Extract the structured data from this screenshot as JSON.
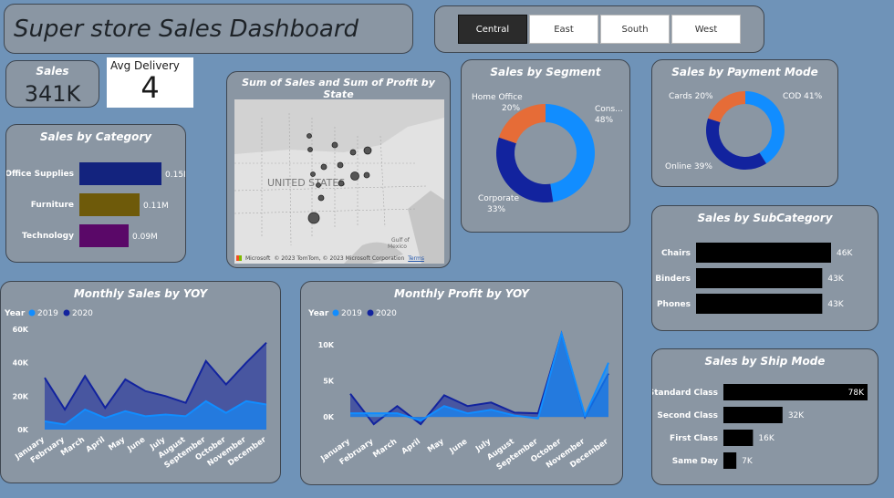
{
  "title": "Super store Sales Dashboard",
  "region_slicer": {
    "options": [
      "Central",
      "East",
      "South",
      "West"
    ],
    "selected": "Central"
  },
  "kpi_sales": {
    "label": "Sales",
    "value": "341K"
  },
  "kpi_delivery": {
    "label": "Avg Delivery",
    "value": "4"
  },
  "map": {
    "title": "Sum of Sales and Sum of Profit by State",
    "country_label": "UNITED STATES",
    "gulf_label": "Gulf of",
    "gulf_label2": "Mexico",
    "copyright": "© 2023 TomTom, © 2023 Microsoft Corporation",
    "terms": "Terms",
    "brand": "Microsoft"
  },
  "chart_data": [
    {
      "id": "category",
      "type": "bar",
      "title": "Sales by Category",
      "categories": [
        "Office Supplies",
        "Furniture",
        "Technology"
      ],
      "values": [
        0.15,
        0.11,
        0.09
      ],
      "labels": [
        "0.15M",
        "0.11M",
        "0.09M"
      ],
      "colors": [
        "#13237e",
        "#6e5a0a",
        "#5a0868"
      ]
    },
    {
      "id": "segment",
      "type": "pie",
      "title": "Sales by Segment",
      "categories": [
        "Consumer",
        "Corporate",
        "Home Office"
      ],
      "values": [
        48,
        33,
        20
      ],
      "labels": [
        [
          "Cons...",
          "48%"
        ],
        [
          "Corporate",
          "33%"
        ],
        [
          "Home Office",
          "20%"
        ]
      ],
      "colors": [
        "#118dff",
        "#12239e",
        "#e66c37"
      ]
    },
    {
      "id": "payment",
      "type": "pie",
      "title": "Sales by Payment Mode",
      "categories": [
        "COD",
        "Online",
        "Cards"
      ],
      "values": [
        41,
        39,
        20
      ],
      "labels": [
        "COD 41%",
        "Online 39%",
        "Cards 20%"
      ],
      "colors": [
        "#118dff",
        "#12239e",
        "#e66c37"
      ]
    },
    {
      "id": "subcategory",
      "type": "bar",
      "title": "Sales by SubCategory",
      "categories": [
        "Chairs",
        "Binders",
        "Phones"
      ],
      "values": [
        46,
        43,
        43
      ],
      "labels": [
        "46K",
        "43K",
        "43K"
      ]
    },
    {
      "id": "shipmode",
      "type": "bar",
      "title": "Sales by Ship Mode",
      "categories": [
        "Standard Class",
        "Second Class",
        "First Class",
        "Same Day"
      ],
      "values": [
        78,
        32,
        16,
        7
      ],
      "labels": [
        "78K",
        "32K",
        "16K",
        "7K"
      ]
    },
    {
      "id": "monthly_sales",
      "type": "area",
      "title": "Monthly Sales by YOY",
      "legend_title": "Year",
      "categories": [
        "January",
        "February",
        "March",
        "April",
        "May",
        "June",
        "July",
        "August",
        "September",
        "October",
        "November",
        "December"
      ],
      "series": [
        {
          "name": "2019",
          "values": [
            5000,
            3000,
            12000,
            7000,
            11000,
            8000,
            9000,
            8000,
            17000,
            10000,
            17000,
            15000
          ],
          "color": "#118dff"
        },
        {
          "name": "2020",
          "values": [
            31000,
            12000,
            32000,
            13000,
            30000,
            23000,
            20000,
            16000,
            41000,
            27000,
            40000,
            52000
          ],
          "color": "#12239e"
        }
      ],
      "yticks": [
        "0K",
        "20K",
        "40K",
        "60K"
      ],
      "ylim": [
        0,
        60000
      ]
    },
    {
      "id": "monthly_profit",
      "type": "area",
      "title": "Monthly Profit by YOY",
      "legend_title": "Year",
      "categories": [
        "January",
        "February",
        "March",
        "April",
        "May",
        "June",
        "July",
        "August",
        "September",
        "October",
        "November",
        "December"
      ],
      "series": [
        {
          "name": "2019",
          "values": [
            500,
            500,
            500,
            -500,
            1500,
            500,
            1000,
            200,
            -200,
            11500,
            200,
            7500
          ],
          "color": "#118dff"
        },
        {
          "name": "2020",
          "values": [
            3200,
            -1000,
            1500,
            -1000,
            3000,
            1500,
            2000,
            600,
            500,
            11500,
            0,
            6000
          ],
          "color": "#12239e"
        }
      ],
      "yticks": [
        "0K",
        "5K",
        "10K"
      ],
      "ylim": [
        -2000,
        12000
      ]
    }
  ]
}
